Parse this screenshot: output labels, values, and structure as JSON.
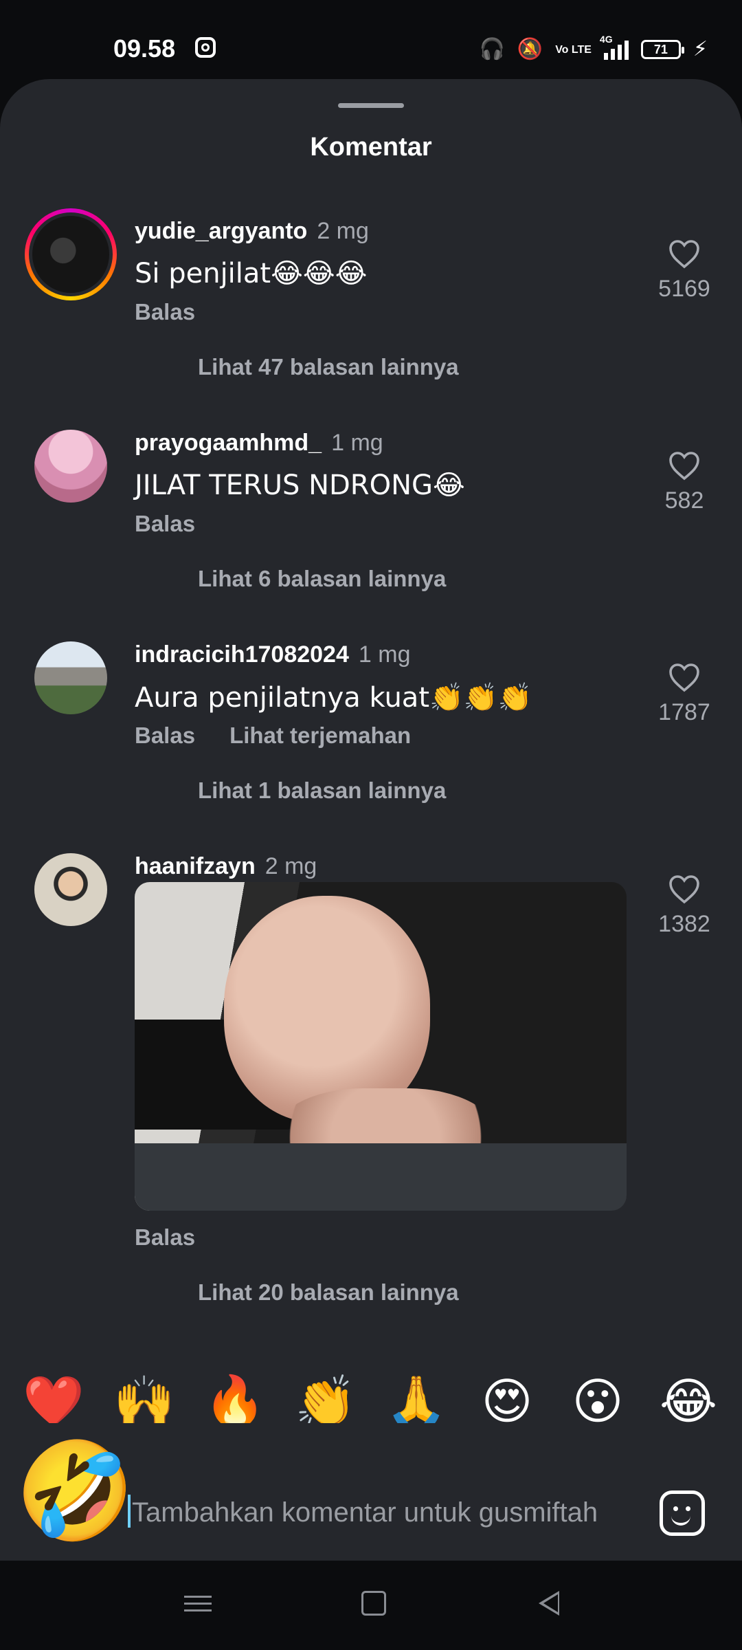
{
  "status_bar": {
    "time": "09.58",
    "volte": "Vo LTE",
    "network": "4G",
    "battery": "71"
  },
  "sheet": {
    "title": "Komentar"
  },
  "comments": [
    {
      "username": "yudie_argyanto",
      "time_ago": "2 mg",
      "text": "Si penjilat😂😂😂",
      "reply_label": "Balas",
      "likes": "5169",
      "view_replies": "Lihat 47 balasan lainnya"
    },
    {
      "username": "prayogaamhmd_",
      "time_ago": "1 mg",
      "text": "JILAT TERUS NDRONG😂",
      "reply_label": "Balas",
      "likes": "582",
      "view_replies": "Lihat 6 balasan lainnya"
    },
    {
      "username": "indracicih17082024",
      "time_ago": "1 mg",
      "text": "Aura penjilatnya kuat👏👏👏",
      "reply_label": "Balas",
      "translate_label": "Lihat terjemahan",
      "likes": "1787",
      "view_replies": "Lihat 1 balasan lainnya"
    },
    {
      "username": "haanifzayn",
      "time_ago": "2 mg",
      "reply_label": "Balas",
      "likes": "1382",
      "view_replies": "Lihat 20 balasan lainnya"
    }
  ],
  "emoji_bar": [
    "❤️",
    "🙌",
    "🔥",
    "👏",
    "🙏",
    "😍",
    "😮",
    "😂"
  ],
  "input": {
    "avatar_emoji": "🤣",
    "placeholder": "Tambahkan komentar untuk gusmiftah"
  },
  "colors": {
    "background": "#0b0c0e",
    "sheet": "#25272c",
    "secondary_text": "#a8abb2"
  }
}
